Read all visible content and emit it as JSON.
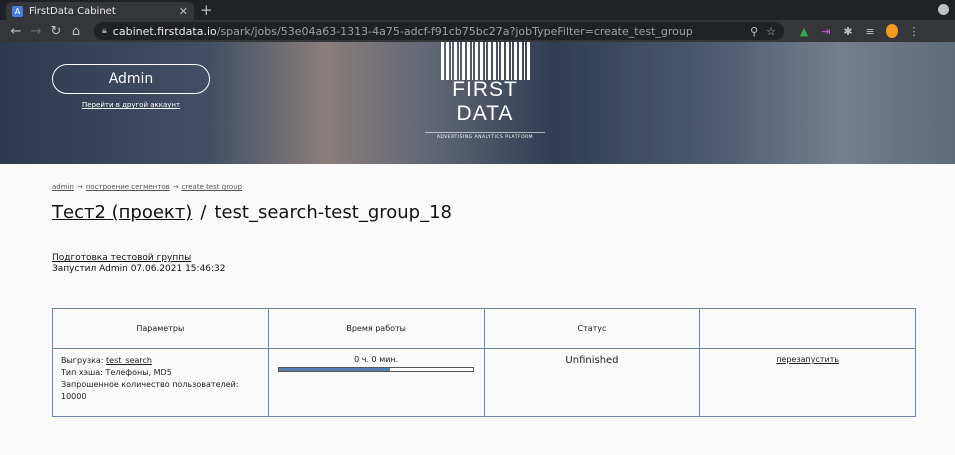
{
  "browser": {
    "tab_title": "FirstData Cabinet",
    "tab_favicon": "A",
    "new_tab": "+",
    "close": "✕",
    "url_host": "cabinet.firstdata.io",
    "url_rest": "/spark/jobs/53e04a63-1313-4a75-adcf-f91cb75bc27a?jobTypeFilter=create_test_group"
  },
  "banner": {
    "admin_label": "Admin",
    "other_account_link": "Перейти в другой аккаунт",
    "logo_text": "FIRST DATA",
    "logo_sub": "ADVERTISING ANALYTICS PLATFORM"
  },
  "breadcrumb": {
    "items": [
      "admin",
      "построение сегментов",
      "create test group"
    ],
    "separator": "→"
  },
  "title": {
    "project": "Тест2 (проект)",
    "separator": "/",
    "job": "test_search-test_group_18"
  },
  "job_info": {
    "type_link": "Подготовка тестовой группы",
    "launched": "Запустил Admin 07.06.2021 15:46:32"
  },
  "table": {
    "headers": [
      "Параметры",
      "Время работы",
      "Статус",
      ""
    ],
    "row": {
      "params": {
        "upload_label": "Выгрузка: ",
        "upload_link": "test_search",
        "hash_type": "Тип хэша: Телефоны, MD5",
        "requested_label": "Запрошенное количество пользователей:",
        "requested_value": "10000"
      },
      "time": "0 ч. 0 мин.",
      "progress": 0.57,
      "status": "Unfinished",
      "action": "перезапустить"
    }
  },
  "colors": {
    "accent": "#5a7fae",
    "table_border": "#6a86b0"
  }
}
